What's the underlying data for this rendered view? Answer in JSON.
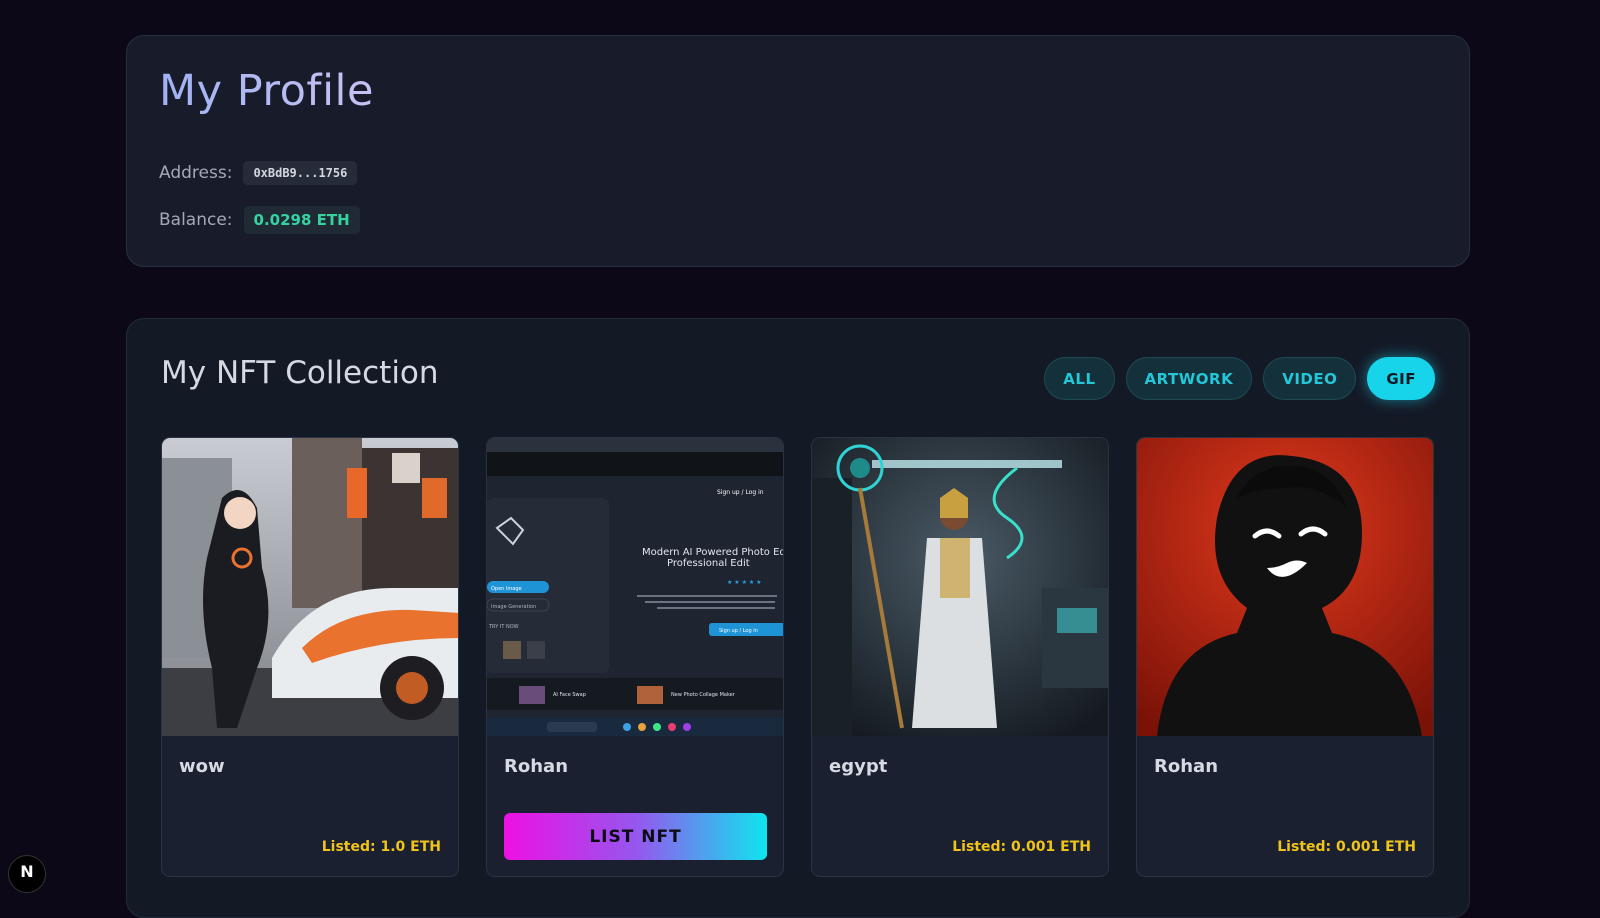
{
  "profile": {
    "title": "My Profile",
    "address_label": "Address:",
    "address_value": "0xBdB9...1756",
    "balance_label": "Balance:",
    "balance_value": "0.0298 ETH"
  },
  "collection": {
    "title": "My NFT Collection",
    "filters": [
      {
        "label": "ALL",
        "active": false
      },
      {
        "label": "ARTWORK",
        "active": false
      },
      {
        "label": "VIDEO",
        "active": false
      },
      {
        "label": "GIF",
        "active": true
      }
    ],
    "items": [
      {
        "name": "wow",
        "status": "Listed: 1.0 ETH",
        "image": "anime-girl-sports-car"
      },
      {
        "name": "Rohan",
        "action_label": "LIST NFT",
        "image": "ai-photo-editor-screenshot"
      },
      {
        "name": "egypt",
        "status": "Listed: 0.001 ETH",
        "image": "egyptian-queen-lab"
      },
      {
        "name": "Rohan",
        "status": "Listed: 0.001 ETH",
        "image": "smiling-silhouette-red"
      }
    ],
    "thumb2": {
      "signup": "Sign up / Log in",
      "headline1": "Modern AI Powered Photo Edito",
      "headline2": "Professional Edit",
      "stars": "★ ★ ★ ★ ★",
      "cta": "Sign up / Log in",
      "open_image": "Open Image",
      "image_generation": "Image Generation",
      "try_it_now": "TRY IT NOW",
      "face_swap": "AI Face Swap",
      "collage": "New Photo Collage Maker"
    }
  },
  "framework_badge": "N",
  "colors": {
    "background": "#0d0818",
    "accent_cyan": "#18d4ea",
    "balance_green": "#36d3a0",
    "price_yellow": "#f0c419"
  }
}
